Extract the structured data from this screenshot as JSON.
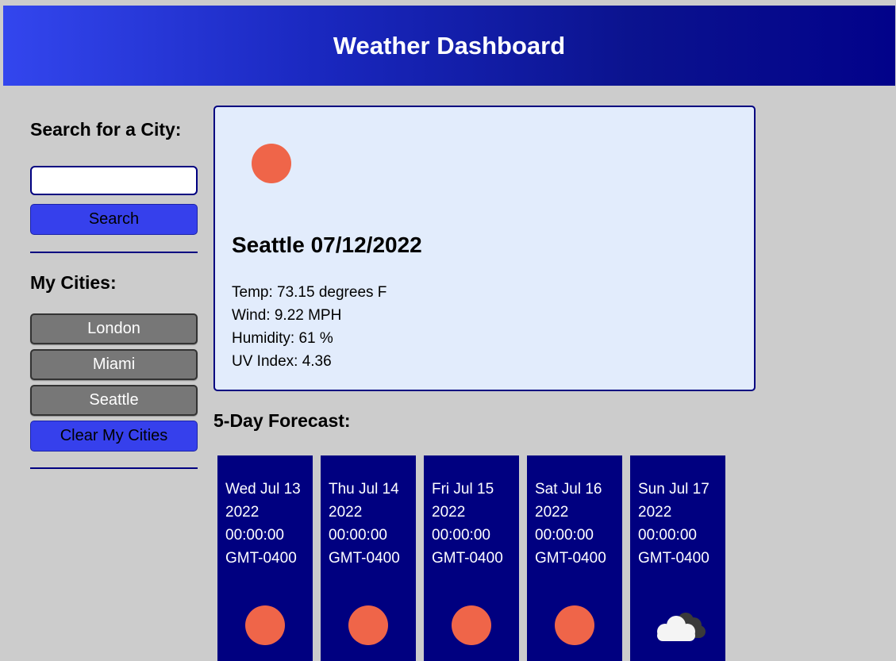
{
  "header": {
    "title": "Weather Dashboard"
  },
  "sidebar": {
    "search_label": "Search for a City:",
    "search_value": "",
    "search_placeholder": "",
    "search_button": "Search",
    "my_cities_label": "My Cities:",
    "cities": [
      "London",
      "Miami",
      "Seattle"
    ],
    "clear_button": "Clear My Cities"
  },
  "current": {
    "icon": "sun-icon",
    "city_date": "Seattle 07/12/2022",
    "temp": "Temp: 73.15 degrees F",
    "wind": "Wind: 9.22 MPH",
    "humidity": "Humidity: 61 %",
    "uv": "UV Index: 4.36"
  },
  "forecast": {
    "title": "5-Day Forecast:",
    "days": [
      {
        "line1": "Wed Jul 13",
        "line2": "2022",
        "line3": "00:00:00",
        "line4": "GMT-0400",
        "icon": "sun-icon"
      },
      {
        "line1": "Thu Jul 14",
        "line2": "2022",
        "line3": "00:00:00",
        "line4": "GMT-0400",
        "icon": "sun-icon"
      },
      {
        "line1": "Fri Jul 15",
        "line2": "2022",
        "line3": "00:00:00",
        "line4": "GMT-0400",
        "icon": "sun-icon"
      },
      {
        "line1": "Sat Jul 16",
        "line2": "2022",
        "line3": "00:00:00",
        "line4": "GMT-0400",
        "icon": "sun-icon"
      },
      {
        "line1": "Sun Jul 17",
        "line2": "2022",
        "line3": "00:00:00",
        "line4": "GMT-0400",
        "icon": "cloud-icon"
      }
    ]
  },
  "colors": {
    "background": "#cccccc",
    "navy": "#000080",
    "accent_blue": "#3640ec",
    "city_button": "#777777",
    "card_background": "#e2ecfc",
    "sun": "#ef6549"
  }
}
